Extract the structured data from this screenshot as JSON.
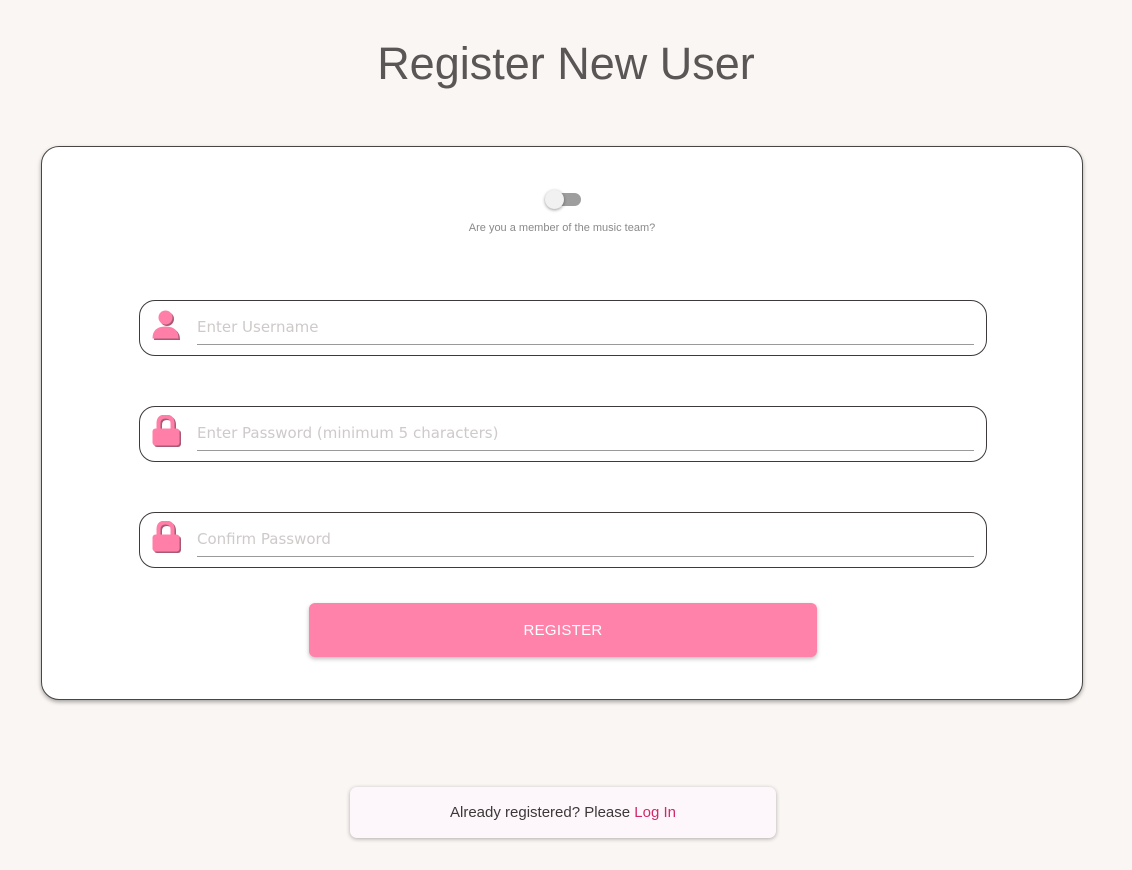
{
  "page": {
    "title": "Register New User"
  },
  "music_team_toggle": {
    "caption": "Are you a member of the music team?",
    "checked": false
  },
  "form": {
    "username": {
      "placeholder": "Enter Username",
      "value": "",
      "icon": "user-icon"
    },
    "password": {
      "placeholder": "Enter Password (minimum 5 characters)",
      "value": "",
      "icon": "lock-icon"
    },
    "confirm_password": {
      "placeholder": "Confirm Password",
      "value": "",
      "icon": "lock-icon"
    },
    "register_label": "REGISTER"
  },
  "login_prompt": {
    "text": "Already registered? Please ",
    "link_label": "Log In"
  },
  "colors": {
    "background": "#faf6f3",
    "accent": "#ff82ab",
    "link": "#d1286a",
    "icon": "#ff7fa8"
  }
}
